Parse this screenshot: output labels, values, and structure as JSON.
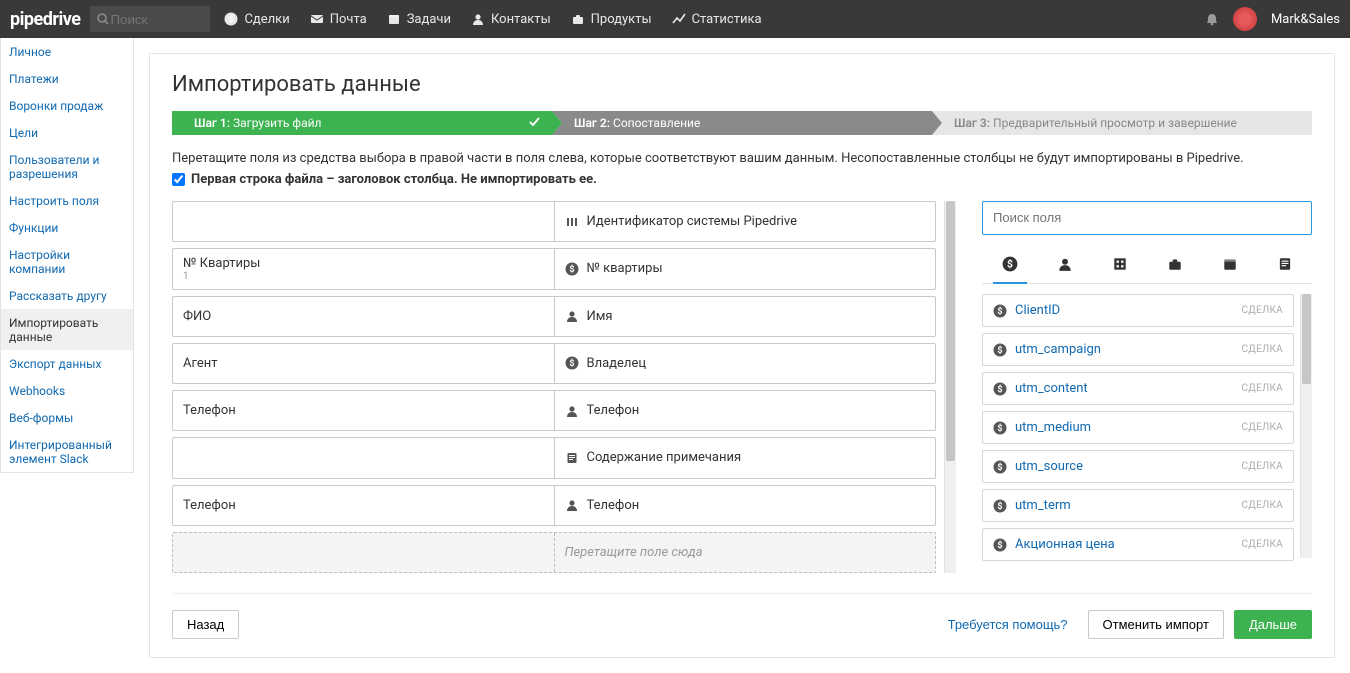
{
  "top": {
    "logo": "pipedrive",
    "search_placeholder": "Поиск",
    "nav": {
      "deals": "Сделки",
      "mail": "Почта",
      "tasks": "Задачи",
      "contacts": "Контакты",
      "products": "Продукты",
      "stats": "Статистика"
    },
    "user": "Mark&Sales"
  },
  "sidebar": {
    "items": [
      "Личное",
      "Платежи",
      "Воронки продаж",
      "Цели",
      "Пользователи и разрешения",
      "Настроить поля",
      "Функции",
      "Настройки компании",
      "Рассказать другу",
      "Импортировать данные",
      "Экспорт данных",
      "Webhooks",
      "Веб-формы",
      "Интегрированный элемент Slack"
    ]
  },
  "page": {
    "title": "Импортировать данные",
    "steps": {
      "s1l": "Шаг 1:",
      "s1t": "Загрузить файл",
      "s2l": "Шаг 2:",
      "s2t": "Сопоставление",
      "s3l": "Шаг 3:",
      "s3t": "Предварительный просмотр и завершение"
    },
    "instruction": "Перетащите поля из средства выбора в правой части в поля слева, которые соответствуют вашим данным. Несопоставленные столбцы не будут импортированы в Pipedrive.",
    "cb_label": "Первая строка файла – заголовок столбца. Не импортировать ее.",
    "rows": [
      {
        "left": "",
        "sub": "",
        "right": "Идентификатор системы Pipedrive",
        "icon": "bars"
      },
      {
        "left": "№ Квартиры",
        "sub": "1",
        "right": "№ квартиры",
        "icon": "dollar"
      },
      {
        "left": "ФИО",
        "sub": "",
        "right": "Имя",
        "icon": "person"
      },
      {
        "left": "Агент",
        "sub": "",
        "right": "Владелец",
        "icon": "dollar"
      },
      {
        "left": "Телефон",
        "sub": "",
        "right": "Телефон",
        "icon": "person"
      },
      {
        "left": "",
        "sub": "",
        "right": "Содержание примечания",
        "icon": "note"
      },
      {
        "left": "Телефон",
        "sub": "",
        "right": "Телефон",
        "icon": "person"
      }
    ],
    "drop_placeholder": "Перетащите поле сюда",
    "fields_search_placeholder": "Поиск поля",
    "fields": [
      {
        "name": "ClientID",
        "type": "СДЕЛКА"
      },
      {
        "name": "utm_campaign",
        "type": "СДЕЛКА"
      },
      {
        "name": "utm_content",
        "type": "СДЕЛКА"
      },
      {
        "name": "utm_medium",
        "type": "СДЕЛКА"
      },
      {
        "name": "utm_source",
        "type": "СДЕЛКА"
      },
      {
        "name": "utm_term",
        "type": "СДЕЛКА"
      },
      {
        "name": "Акционная цена",
        "type": "СДЕЛКА"
      }
    ],
    "footer": {
      "back": "Назад",
      "help": "Требуется помощь?",
      "cancel": "Отменить импорт",
      "next": "Дальше"
    }
  }
}
